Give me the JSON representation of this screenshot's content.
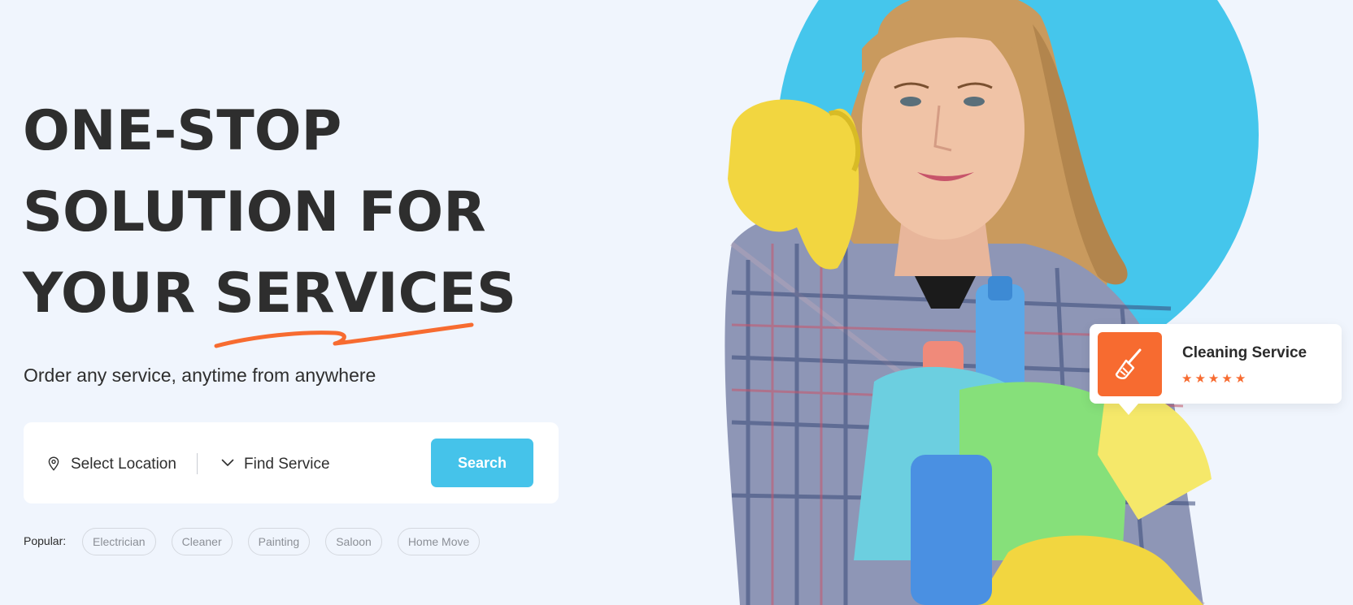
{
  "hero": {
    "line1": "ONE-STOP",
    "line2": "SOLUTION FOR",
    "line3_prefix": "YOUR ",
    "line3_highlight": "SERVICES",
    "subtitle": "Order any service, anytime from anywhere"
  },
  "search": {
    "location_label": "Select Location",
    "service_label": "Find Service",
    "button_label": "Search"
  },
  "popular": {
    "label": "Popular:",
    "tags": [
      "Electrician",
      "Cleaner",
      "Painting",
      "Saloon",
      "Home Move"
    ]
  },
  "service_card": {
    "title": "Cleaning Service",
    "rating": 5,
    "icon": "broom-icon"
  },
  "colors": {
    "accent_blue": "#45c3ea",
    "accent_orange": "#f76b30",
    "background": "#f0f5fd",
    "text_dark": "#2e2e2e"
  }
}
